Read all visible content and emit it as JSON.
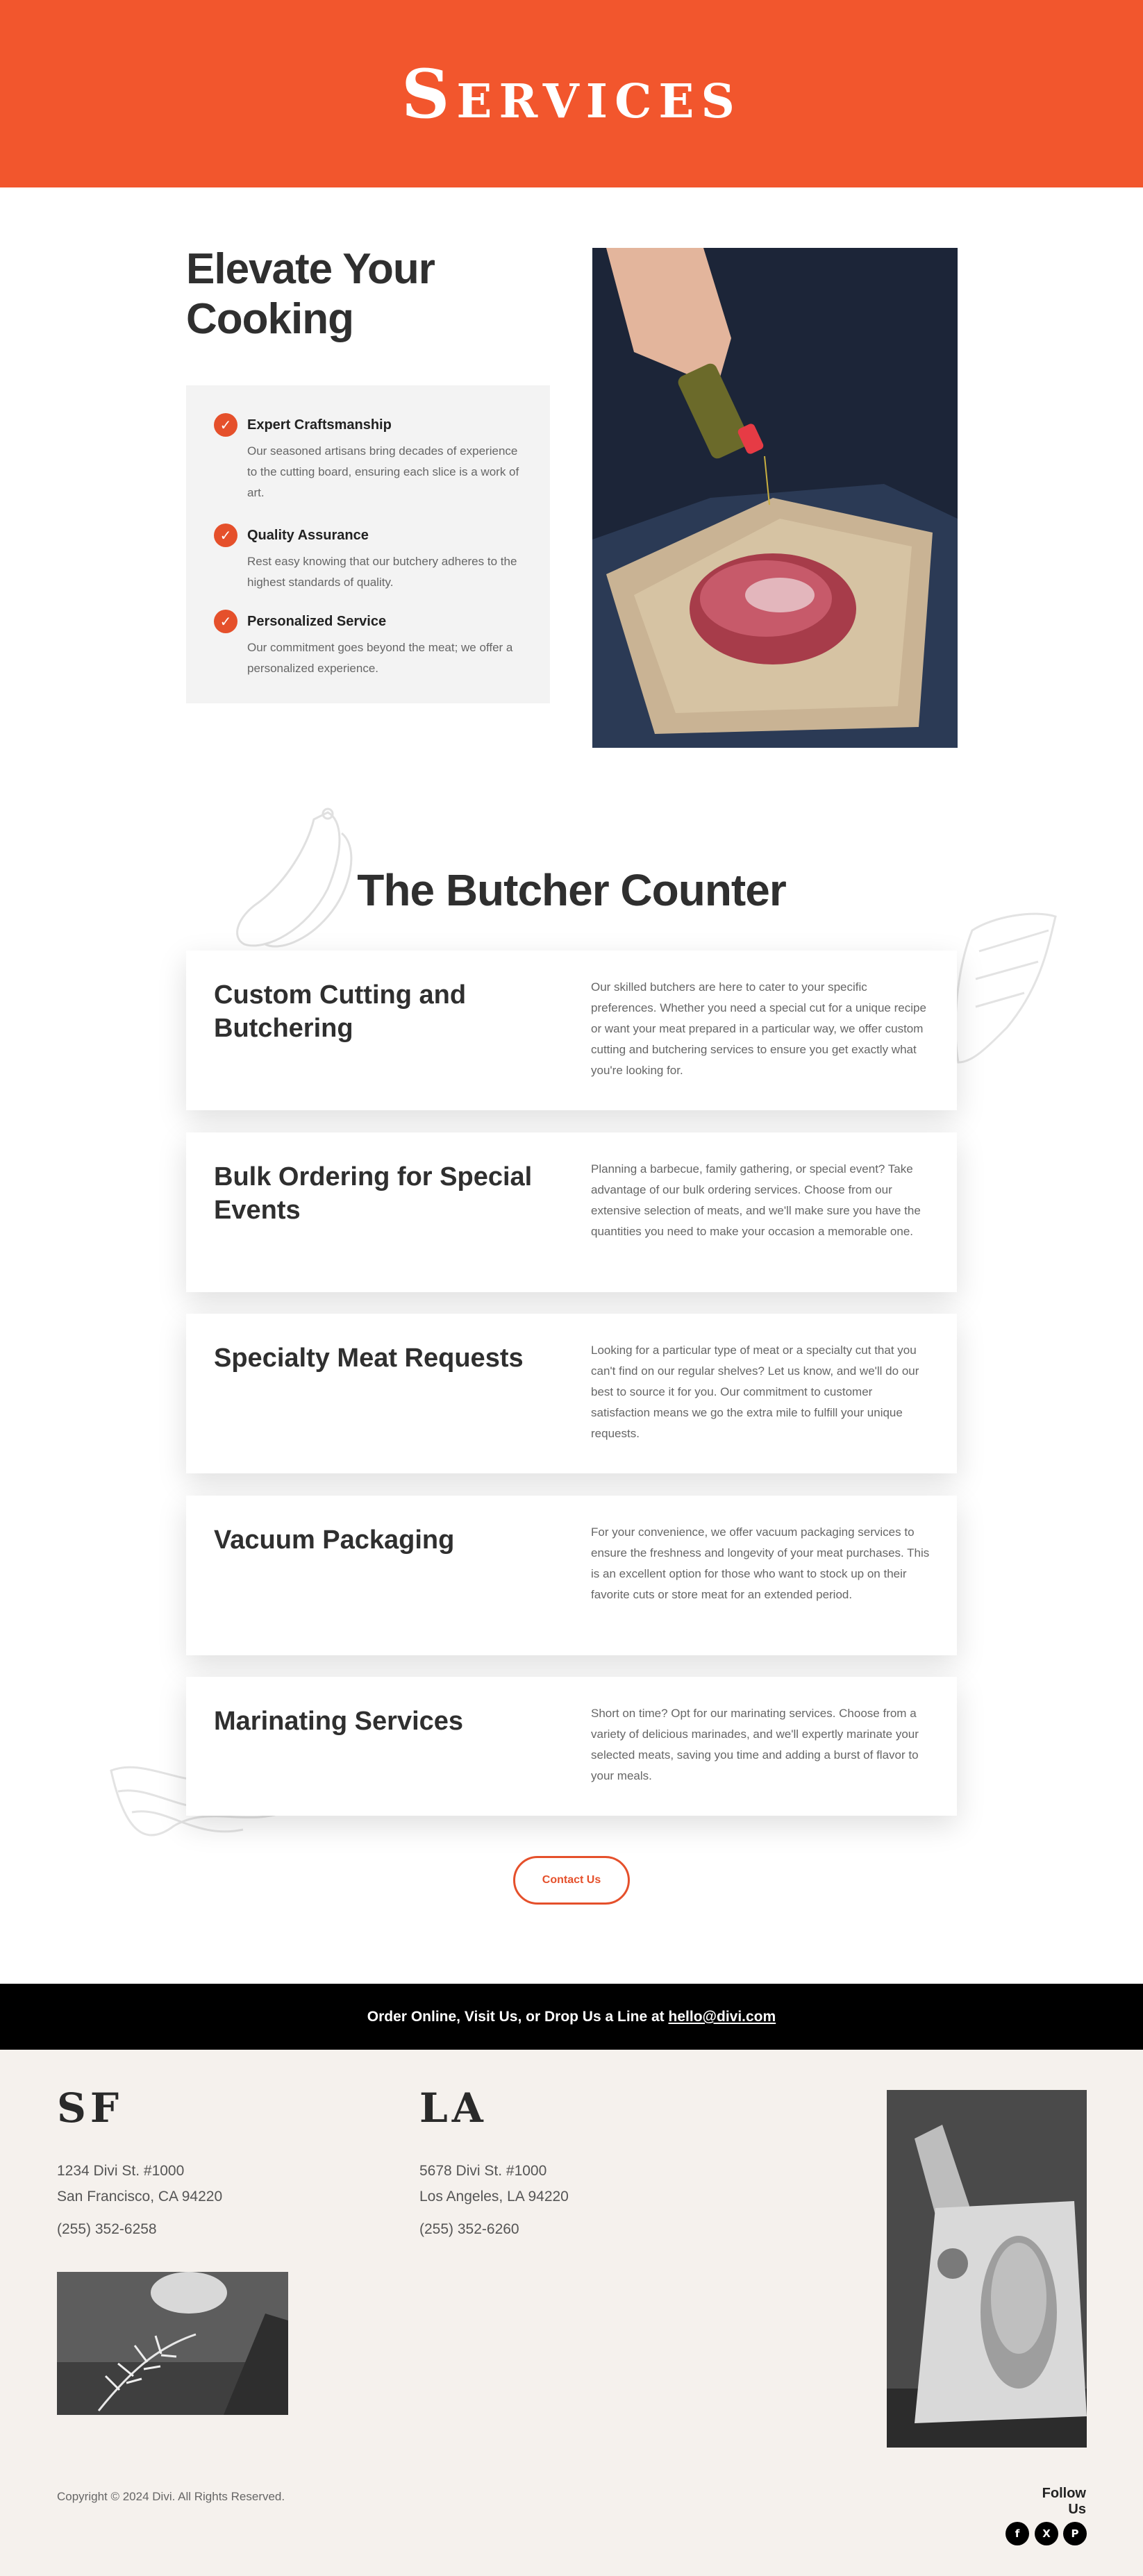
{
  "hero": {
    "title": "Services",
    "bg_color": "#f2562d"
  },
  "intro": {
    "heading_line1": "Elevate Your",
    "heading_line2": "Cooking",
    "features": [
      {
        "title": "Expert Craftsmanship",
        "text": "Our seasoned artisans bring decades of experience to the cutting board, ensuring each slice is a work of art.",
        "icon": "check-icon"
      },
      {
        "title": "Quality Assurance",
        "text": "Rest easy knowing that our butchery adheres to the highest standards of quality.",
        "icon": "check-icon"
      },
      {
        "title": "Personalized Service",
        "text": "Our commitment goes beyond the meat; we offer a personalized experience.",
        "icon": "check-icon"
      }
    ]
  },
  "counter": {
    "title": "The Butcher Counter",
    "services": [
      {
        "title": "Custom Cutting and Butchering",
        "text": "Our skilled butchers are here to cater to your specific preferences. Whether you need a special cut for a unique recipe or want your meat prepared in a particular way, we offer custom cutting and butchering services to ensure you get exactly what you're looking for."
      },
      {
        "title": "Bulk Ordering for Special Events",
        "text": "Planning a barbecue, family gathering, or special event? Take advantage of our bulk ordering services. Choose from our extensive selection of meats, and we'll make sure you have the quantities you need to make your occasion a memorable one."
      },
      {
        "title": "Specialty Meat Requests",
        "text": "Looking for a particular type of meat or a specialty cut that you can't find on our regular shelves? Let us know, and we'll do our best to source it for you. Our commitment to customer satisfaction means we go the extra mile to fulfill your unique requests."
      },
      {
        "title": "Vacuum Packaging",
        "text": "For your convenience, we offer vacuum packaging services to ensure the freshness and longevity of your meat purchases. This is an excellent option for those who want to stock up on their favorite cuts or store meat for an extended period."
      },
      {
        "title": "Marinating Services",
        "text": "Short on time? Opt for our marinating services. Choose from a variety of delicious marinades, and we'll expertly marinate your selected meats, saving you time and adding a burst of flavor to your meals."
      }
    ],
    "contact_button": "Contact Us"
  },
  "cta": {
    "text": "Order Online, Visit Us, or Drop Us a Line at ",
    "email": "hello@divi.com"
  },
  "footer": {
    "locations": [
      {
        "code": "SF",
        "address1": "1234 Divi St. #1000",
        "address2": "San Francisco, CA 94220",
        "phone": "(255) 352-6258"
      },
      {
        "code": "LA",
        "address1": "5678 Divi St. #1000",
        "address2": "Los Angeles, LA 94220",
        "phone": "(255) 352-6260"
      }
    ],
    "copyright": "Copyright © 2024 Divi. All Rights Reserved.",
    "follow_label": "Follow Us",
    "social": [
      {
        "icon": "facebook-icon",
        "glyph": "f"
      },
      {
        "icon": "x-icon",
        "glyph": "X"
      },
      {
        "icon": "pinterest-icon",
        "glyph": "P"
      }
    ]
  },
  "colors": {
    "accent": "#e5502b",
    "footer_bg": "#f5f1ed",
    "cta_bg": "#000000"
  }
}
